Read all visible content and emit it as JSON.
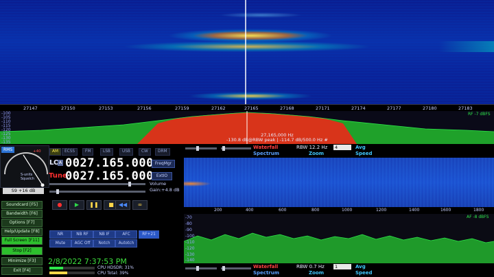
{
  "ruler": {
    "ticks": [
      "27147",
      "27150",
      "27153",
      "27156",
      "27159",
      "27162",
      "27165",
      "27168",
      "27171",
      "27174",
      "27177",
      "27180",
      "27183"
    ]
  },
  "spectrum": {
    "db_labels": [
      "-100",
      "-105",
      "-110",
      "-115",
      "-120",
      "-125",
      "-130",
      "-135"
    ],
    "rf_label": "RF -7 dBFS",
    "info_line1": "27,165,000 Hz",
    "info_line2": "-130.8 dB@RBW peak  |  -114.7 dB/500.0 Hz #"
  },
  "meter": {
    "rms": "RMS",
    "scale_text": "S-units",
    "squelch_text": "Squelch",
    "plus40": "+40",
    "value": "S9 +16 dB"
  },
  "left_buttons": [
    {
      "label": "Soundcard  [F5]",
      "on": false
    },
    {
      "label": "Bandwidth  [F6]",
      "on": false
    },
    {
      "label": "Options  [F7]",
      "on": false
    },
    {
      "label": "Help/Update  [F8]",
      "on": false
    },
    {
      "label": "Full Screen  [F11]",
      "on": true
    },
    {
      "label": "Stop  [F2]",
      "on": true
    },
    {
      "label": "Minimize  [F3]",
      "on": false
    },
    {
      "label": "Exit  [F4]",
      "on": false
    }
  ],
  "modes": [
    "AM",
    "ECSS",
    "FM",
    "LSB",
    "USB",
    "CW",
    "DRM"
  ],
  "lo": {
    "label": "LO",
    "badge": "A",
    "freq": "0027.165.000"
  },
  "tune": {
    "label": "Tune",
    "freq": "0027.165.000"
  },
  "side_buttons": {
    "freqmgr": "FreqMgr",
    "extio": "ExtIO"
  },
  "volume": {
    "label": "Volume",
    "gain": "Gain:+4.8 dB"
  },
  "transport": [
    "●",
    "▶",
    "❚❚",
    "■",
    "◀◀",
    "∞"
  ],
  "filters_row1": [
    "NR",
    "NB RF",
    "NB IF",
    "AFC"
  ],
  "filters_row2": [
    "Mute",
    "AGC Off",
    "Notch",
    "Autotch"
  ],
  "rf_badge": "RF+21",
  "clock": "2/8/2022 7:37:53 PM",
  "cpu": {
    "hdsdr": "CPU HDSDR: 31%",
    "total": "CPU Total:  39%"
  },
  "audio_controls_top": {
    "waterfall": "Waterfall",
    "spectrum": "Spectrum",
    "zoom": "Zoom",
    "speed": "Speed",
    "rbw": "RBW 12.2 Hz",
    "avg_value": "4",
    "avg": "Avg"
  },
  "audio_ruler": [
    "200",
    "400",
    "600",
    "800",
    "1000",
    "1200",
    "1400",
    "1600",
    "1800"
  ],
  "audio_db": [
    "-70",
    "-80",
    "-90",
    "-100",
    "-110",
    "-120",
    "-130",
    "-140"
  ],
  "af_label": "AF -8 dBFS",
  "audio_controls_bottom": {
    "waterfall": "Waterfall",
    "spectrum": "Spectrum",
    "zoom": "Zoom",
    "speed": "Speed",
    "rbw": "RBW 0.7 Hz",
    "avg_value": "1",
    "avg": "Avg"
  },
  "colors": {
    "accent": "#2d74d6",
    "green": "#2dbf2d",
    "red_wf": "#ff4040",
    "spectrum_red": "#e0361a"
  }
}
